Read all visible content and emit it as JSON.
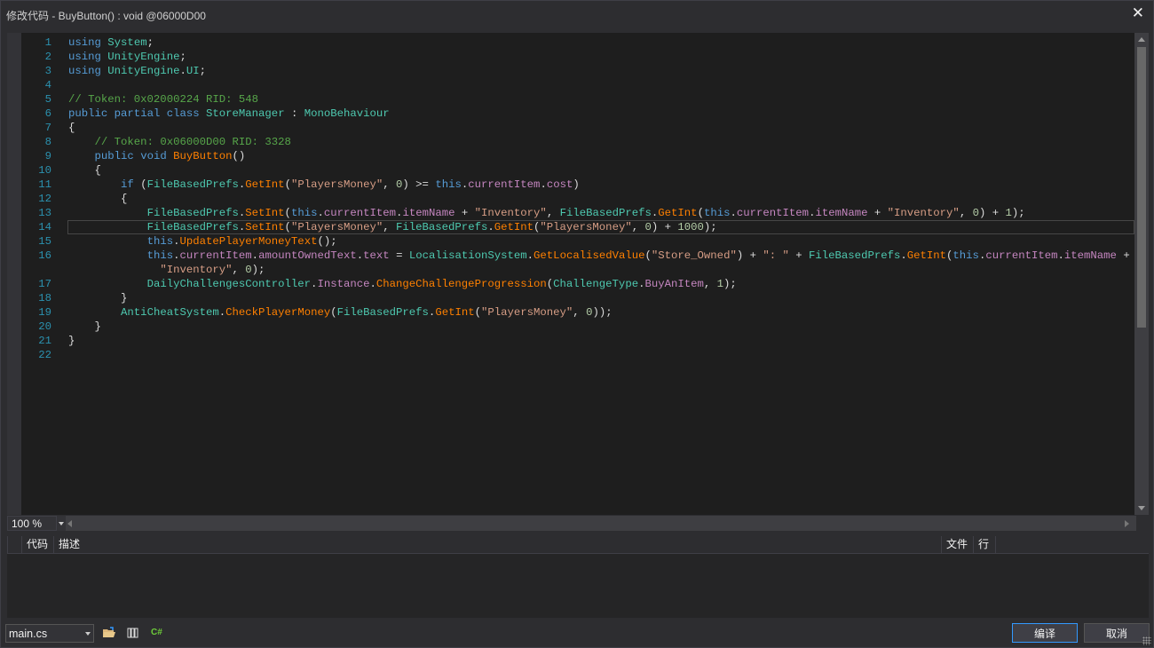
{
  "window": {
    "title": "修改代码 - BuyButton() : void @06000D00",
    "close_glyph": "✕"
  },
  "editor": {
    "lines": [
      {
        "num": "1",
        "tokens": [
          [
            "kw",
            "using"
          ],
          [
            "pn",
            " "
          ],
          [
            "ty",
            "System"
          ],
          [
            "pn",
            ";"
          ]
        ]
      },
      {
        "num": "2",
        "tokens": [
          [
            "kw",
            "using"
          ],
          [
            "pn",
            " "
          ],
          [
            "ty",
            "UnityEngine"
          ],
          [
            "pn",
            ";"
          ]
        ]
      },
      {
        "num": "3",
        "tokens": [
          [
            "kw",
            "using"
          ],
          [
            "pn",
            " "
          ],
          [
            "ty",
            "UnityEngine"
          ],
          [
            "pn",
            "."
          ],
          [
            "ty",
            "UI"
          ],
          [
            "pn",
            ";"
          ]
        ]
      },
      {
        "num": "4",
        "tokens": []
      },
      {
        "num": "5",
        "tokens": [
          [
            "cm",
            "// Token: 0x02000224 RID: 548"
          ]
        ]
      },
      {
        "num": "6",
        "tokens": [
          [
            "kw",
            "public"
          ],
          [
            "pn",
            " "
          ],
          [
            "kw",
            "partial"
          ],
          [
            "pn",
            " "
          ],
          [
            "kw",
            "class"
          ],
          [
            "pn",
            " "
          ],
          [
            "ty",
            "StoreManager"
          ],
          [
            "pn",
            " : "
          ],
          [
            "ty",
            "MonoBehaviour"
          ]
        ]
      },
      {
        "num": "7",
        "tokens": [
          [
            "pn",
            "{"
          ]
        ]
      },
      {
        "num": "8",
        "tokens": [
          [
            "pn",
            "    "
          ],
          [
            "cm",
            "// Token: 0x06000D00 RID: 3328"
          ]
        ]
      },
      {
        "num": "9",
        "tokens": [
          [
            "pn",
            "    "
          ],
          [
            "kw",
            "public"
          ],
          [
            "pn",
            " "
          ],
          [
            "kw",
            "void"
          ],
          [
            "pn",
            " "
          ],
          [
            "me",
            "BuyButton"
          ],
          [
            "pn",
            "()"
          ]
        ]
      },
      {
        "num": "10",
        "tokens": [
          [
            "pn",
            "    {"
          ]
        ]
      },
      {
        "num": "11",
        "tokens": [
          [
            "pn",
            "        "
          ],
          [
            "kw",
            "if"
          ],
          [
            "pn",
            " ("
          ],
          [
            "ty",
            "FileBasedPrefs"
          ],
          [
            "pn",
            "."
          ],
          [
            "me",
            "GetInt"
          ],
          [
            "pn",
            "("
          ],
          [
            "st",
            "\"PlayersMoney\""
          ],
          [
            "pn",
            ", "
          ],
          [
            "nu",
            "0"
          ],
          [
            "pn",
            ") >= "
          ],
          [
            "kw",
            "this"
          ],
          [
            "pn",
            "."
          ],
          [
            "pr",
            "currentItem"
          ],
          [
            "pn",
            "."
          ],
          [
            "pr",
            "cost"
          ],
          [
            "pn",
            ")"
          ]
        ]
      },
      {
        "num": "12",
        "tokens": [
          [
            "pn",
            "        {"
          ]
        ]
      },
      {
        "num": "13",
        "tokens": [
          [
            "pn",
            "            "
          ],
          [
            "ty",
            "FileBasedPrefs"
          ],
          [
            "pn",
            "."
          ],
          [
            "me",
            "SetInt"
          ],
          [
            "pn",
            "("
          ],
          [
            "kw",
            "this"
          ],
          [
            "pn",
            "."
          ],
          [
            "pr",
            "currentItem"
          ],
          [
            "pn",
            "."
          ],
          [
            "pr",
            "itemName"
          ],
          [
            "pn",
            " + "
          ],
          [
            "st",
            "\"Inventory\""
          ],
          [
            "pn",
            ", "
          ],
          [
            "ty",
            "FileBasedPrefs"
          ],
          [
            "pn",
            "."
          ],
          [
            "me",
            "GetInt"
          ],
          [
            "pn",
            "("
          ],
          [
            "kw",
            "this"
          ],
          [
            "pn",
            "."
          ],
          [
            "pr",
            "currentItem"
          ],
          [
            "pn",
            "."
          ],
          [
            "pr",
            "itemName"
          ],
          [
            "pn",
            " + "
          ],
          [
            "st",
            "\"Inventory\""
          ],
          [
            "pn",
            ", "
          ],
          [
            "nu",
            "0"
          ],
          [
            "pn",
            ") + "
          ],
          [
            "nu",
            "1"
          ],
          [
            "pn",
            ");"
          ]
        ]
      },
      {
        "num": "14",
        "current": true,
        "tokens": [
          [
            "pn",
            "            "
          ],
          [
            "ty",
            "FileBasedPrefs"
          ],
          [
            "pn",
            "."
          ],
          [
            "me",
            "SetInt"
          ],
          [
            "pn",
            "("
          ],
          [
            "st",
            "\"PlayersMoney\""
          ],
          [
            "pn",
            ", "
          ],
          [
            "ty",
            "FileBasedPrefs"
          ],
          [
            "pn",
            "."
          ],
          [
            "me",
            "GetInt"
          ],
          [
            "pn",
            "("
          ],
          [
            "st",
            "\"PlayersMoney\""
          ],
          [
            "pn",
            ", "
          ],
          [
            "nu",
            "0"
          ],
          [
            "pn",
            ") + "
          ],
          [
            "nu",
            "1000"
          ],
          [
            "pn",
            ");"
          ]
        ]
      },
      {
        "num": "15",
        "tokens": [
          [
            "pn",
            "            "
          ],
          [
            "kw",
            "this"
          ],
          [
            "pn",
            "."
          ],
          [
            "me",
            "UpdatePlayerMoneyText"
          ],
          [
            "pn",
            "();"
          ]
        ]
      },
      {
        "num": "16",
        "tokens": [
          [
            "pn",
            "            "
          ],
          [
            "kw",
            "this"
          ],
          [
            "pn",
            "."
          ],
          [
            "pr",
            "currentItem"
          ],
          [
            "pn",
            "."
          ],
          [
            "pr",
            "amountOwnedText"
          ],
          [
            "pn",
            "."
          ],
          [
            "pr",
            "text"
          ],
          [
            "pn",
            " = "
          ],
          [
            "ty",
            "LocalisationSystem"
          ],
          [
            "pn",
            "."
          ],
          [
            "me",
            "GetLocalisedValue"
          ],
          [
            "pn",
            "("
          ],
          [
            "st",
            "\"Store_Owned\""
          ],
          [
            "pn",
            ") + "
          ],
          [
            "st",
            "\": \""
          ],
          [
            "pn",
            " + "
          ],
          [
            "ty",
            "FileBasedPrefs"
          ],
          [
            "pn",
            "."
          ],
          [
            "me",
            "GetInt"
          ],
          [
            "pn",
            "("
          ],
          [
            "kw",
            "this"
          ],
          [
            "pn",
            "."
          ],
          [
            "pr",
            "currentItem"
          ],
          [
            "pn",
            "."
          ],
          [
            "pr",
            "itemName"
          ],
          [
            "pn",
            " +"
          ]
        ]
      },
      {
        "num": "",
        "tokens": [
          [
            "pn",
            "              "
          ],
          [
            "st",
            "\"Inventory\""
          ],
          [
            "pn",
            ", "
          ],
          [
            "nu",
            "0"
          ],
          [
            "pn",
            ");"
          ]
        ]
      },
      {
        "num": "17",
        "tokens": [
          [
            "pn",
            "            "
          ],
          [
            "ty",
            "DailyChallengesController"
          ],
          [
            "pn",
            "."
          ],
          [
            "pr",
            "Instance"
          ],
          [
            "pn",
            "."
          ],
          [
            "me",
            "ChangeChallengeProgression"
          ],
          [
            "pn",
            "("
          ],
          [
            "ty",
            "ChallengeType"
          ],
          [
            "pn",
            "."
          ],
          [
            "pr",
            "BuyAnItem"
          ],
          [
            "pn",
            ", "
          ],
          [
            "nu",
            "1"
          ],
          [
            "pn",
            ");"
          ]
        ]
      },
      {
        "num": "18",
        "tokens": [
          [
            "pn",
            "        }"
          ]
        ]
      },
      {
        "num": "19",
        "tokens": [
          [
            "pn",
            "        "
          ],
          [
            "ty",
            "AntiCheatSystem"
          ],
          [
            "pn",
            "."
          ],
          [
            "me",
            "CheckPlayerMoney"
          ],
          [
            "pn",
            "("
          ],
          [
            "ty",
            "FileBasedPrefs"
          ],
          [
            "pn",
            "."
          ],
          [
            "me",
            "GetInt"
          ],
          [
            "pn",
            "("
          ],
          [
            "st",
            "\"PlayersMoney\""
          ],
          [
            "pn",
            ", "
          ],
          [
            "nu",
            "0"
          ],
          [
            "pn",
            "));"
          ]
        ]
      },
      {
        "num": "20",
        "tokens": [
          [
            "pn",
            "    }"
          ]
        ]
      },
      {
        "num": "21",
        "tokens": [
          [
            "pn",
            "}"
          ]
        ]
      },
      {
        "num": "22",
        "tokens": []
      }
    ],
    "zoom": "100 %"
  },
  "errors": {
    "col_code": "代码",
    "col_desc": "描述",
    "col_file": "文件",
    "col_line": "行"
  },
  "footer": {
    "file": "main.cs",
    "icons": [
      "open-folder-icon",
      "references-icon",
      "csharp-icon"
    ],
    "csharp_label": "C#",
    "compile_label": "编译",
    "cancel_label": "取消"
  },
  "colors": {
    "keyword": "#569cd6",
    "type": "#4ec9b0",
    "method": "#ff8000",
    "property": "#c586c0",
    "string": "#d69d85",
    "comment": "#57a64a",
    "line_number": "#2b91af",
    "accent": "#3399ff"
  }
}
